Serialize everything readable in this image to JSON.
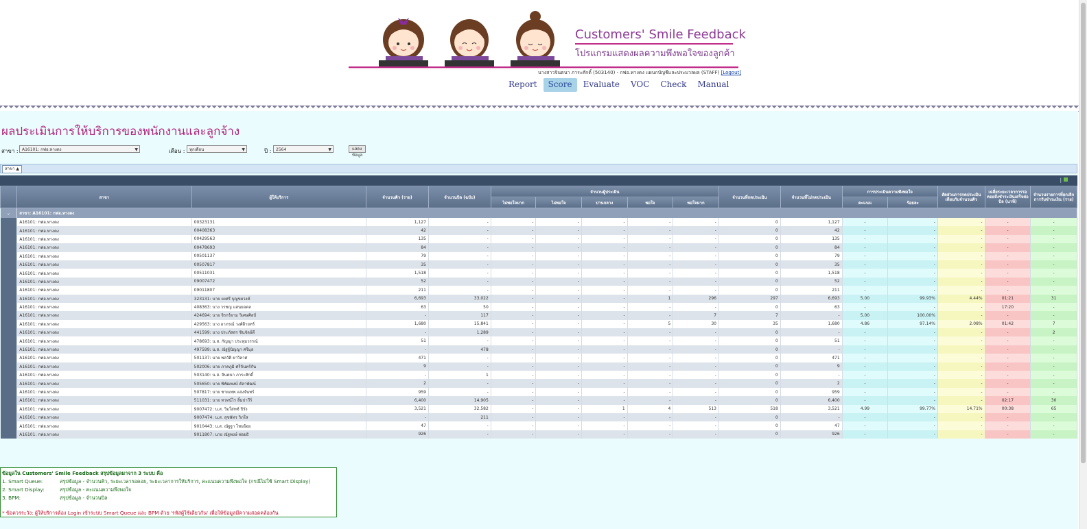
{
  "brand": {
    "title": "Customers' Smile Feedback",
    "subtitle": "โปรแกรมแสดงผลความพึงพอใจของลูกค้า"
  },
  "user": {
    "text": "นางสาวจินตนา ภาระศักดิ์ (503140) - กฟอ.ทางดง แผนกบัญชีและประมวลผล (STAFF)",
    "logout": "[Logout]"
  },
  "menu": [
    {
      "label": "Report",
      "active": false
    },
    {
      "label": "Score",
      "active": true
    },
    {
      "label": "Evaluate",
      "active": false
    },
    {
      "label": "VOC",
      "active": false
    },
    {
      "label": "Check",
      "active": false
    },
    {
      "label": "Manual",
      "active": false
    }
  ],
  "page": {
    "title": "ผลประเมินการให้บริการของพนักงานและลูกจ้าง"
  },
  "filters": {
    "branch_label": "สาขา :",
    "branch_value": "A16101: กฟอ.ทางดง",
    "month_label": "เดือน :",
    "month_value": "ทุกเดือน",
    "year_label": "ปี :",
    "year_value": "2564",
    "submit_label": "แสดงข้อมูล"
  },
  "grouping": {
    "chip": "สาขา ▲"
  },
  "columns": {
    "branch": "สาขา",
    "staff": "ผู้ให้บริการ",
    "queue": "จำนวนคิว (ราย)",
    "bill": "จำนวนบิล (ฉบับ)",
    "raters": "จำนวนผู้ประเมิน",
    "r1": "ไม่พอใจมาก",
    "r2": "ไม่พอใจ",
    "r3": "ปานกลาง",
    "r4": "พอใจ",
    "r5": "พอใจมาก",
    "pressed": "จำนวนที่กดประเมิน",
    "notpressed": "จำนวนที่ไม่กดประเมิน",
    "satisfaction": "การประเมินความพึงพอใจ",
    "score": "คะแนน",
    "percent": "ร้อยละ",
    "ratio": "สัดส่วนการกดประเมินเทียบกับจำนวนคิว",
    "avgtime": "เฉลี่ยระยะเวลาการรอคอยถึงชำระเงินเสร็จต่อบิล (นาที)",
    "bpm": "จำนวนรายการที่ยกเลิกการรับชำระเงิน (ราย)"
  },
  "group_row": {
    "label": "สาขา: A16101: กฟอ.ทางดง"
  },
  "rows": [
    [
      "A16101: กฟอ.ทางดง",
      "00323131",
      "1,127",
      "-",
      "-",
      "-",
      "-",
      "-",
      "-",
      "0",
      "1,127",
      "-",
      "-",
      "-",
      "-",
      "-"
    ],
    [
      "A16101: กฟอ.ทางดง",
      "00408363",
      "42",
      "-",
      "-",
      "-",
      "-",
      "-",
      "-",
      "0",
      "42",
      "-",
      "-",
      "-",
      "-",
      "-"
    ],
    [
      "A16101: กฟอ.ทางดง",
      "00429563",
      "135",
      "-",
      "-",
      "-",
      "-",
      "-",
      "-",
      "0",
      "135",
      "-",
      "-",
      "-",
      "-",
      "-"
    ],
    [
      "A16101: กฟอ.ทางดง",
      "00478693",
      "84",
      "-",
      "-",
      "-",
      "-",
      "-",
      "-",
      "0",
      "84",
      "-",
      "-",
      "-",
      "-",
      "-"
    ],
    [
      "A16101: กฟอ.ทางดง",
      "00501137",
      "79",
      "-",
      "-",
      "-",
      "-",
      "-",
      "-",
      "0",
      "79",
      "-",
      "-",
      "-",
      "-",
      "-"
    ],
    [
      "A16101: กฟอ.ทางดง",
      "00507817",
      "35",
      "-",
      "-",
      "-",
      "-",
      "-",
      "-",
      "0",
      "35",
      "-",
      "-",
      "-",
      "-",
      "-"
    ],
    [
      "A16101: กฟอ.ทางดง",
      "00511031",
      "1,518",
      "-",
      "-",
      "-",
      "-",
      "-",
      "-",
      "0",
      "1,518",
      "-",
      "-",
      "-",
      "-",
      "-"
    ],
    [
      "A16101: กฟอ.ทางดง",
      "09007472",
      "52",
      "-",
      "-",
      "-",
      "-",
      "-",
      "-",
      "0",
      "52",
      "-",
      "-",
      "-",
      "-",
      "-"
    ],
    [
      "A16101: กฟอ.ทางดง",
      "09011807",
      "211",
      "-",
      "-",
      "-",
      "-",
      "-",
      "-",
      "0",
      "211",
      "-",
      "-",
      "-",
      "-",
      "-"
    ],
    [
      "A16101: กฟอ.ทางดง",
      "323131: นาย ยงศรี บุญขยวงค์",
      "6,693",
      "33,022",
      "-",
      "-",
      "-",
      "1",
      "296",
      "297",
      "6,693",
      "5.00",
      "99.93%",
      "4.44%",
      "01:21",
      "31"
    ],
    [
      "A16101: กฟอ.ทางดง",
      "408363: นาง วรชญ แสนยอดล",
      "63",
      "50",
      "-",
      "-",
      "-",
      "-",
      "-",
      "0",
      "63",
      "-",
      "-",
      "-",
      "17:20",
      "-"
    ],
    [
      "A16101: กฟอ.ทางดง",
      "424694: นาย จิรกร์ยาม วิเศษศิลป์",
      "-",
      "117",
      "-",
      "-",
      "-",
      "-",
      "7",
      "7",
      "-",
      "5.00",
      "100.00%",
      "-",
      "-",
      "-"
    ],
    [
      "A16101: กฟอ.ทางดง",
      "429563: นาง อาภรณ์ วงศ์ฝ้ายทร์",
      "1,680",
      "15,841",
      "-",
      "-",
      "-",
      "5",
      "30",
      "35",
      "1,680",
      "4.86",
      "97.14%",
      "2.08%",
      "01:42",
      "7"
    ],
    [
      "A16101: กฟอ.ทางดง",
      "441599: นาง ประภัสสร ชินจัลย์ดี",
      "-",
      "1,289",
      "-",
      "-",
      "-",
      "-",
      "-",
      "0",
      "-",
      "-",
      "-",
      "-",
      "-",
      "2"
    ],
    [
      "A16101: กฟอ.ทางดง",
      "478693: น.ส. กัญญา ประทุมวรรณ์",
      "51",
      "-",
      "-",
      "-",
      "-",
      "-",
      "-",
      "0",
      "51",
      "-",
      "-",
      "-",
      "-",
      "-"
    ],
    [
      "A16101: กฟอ.ทางดง",
      "497599: น.ส. ณัฐฐ์นิญญา ศรีมุล",
      "-",
      "478",
      "-",
      "-",
      "-",
      "-",
      "-",
      "0",
      "-",
      "-",
      "-",
      "-",
      "-",
      "-"
    ],
    [
      "A16101: กฟอ.ทางดง",
      "501137: นาย พลวัติ ยาวิลาศ",
      "471",
      "-",
      "-",
      "-",
      "-",
      "-",
      "-",
      "0",
      "471",
      "-",
      "-",
      "-",
      "-",
      "-"
    ],
    [
      "A16101: กฟอ.ทางดง",
      "502006: นาย ภาคภูมิ ศรีจันทร์กัน",
      "9",
      "-",
      "-",
      "-",
      "-",
      "-",
      "-",
      "0",
      "9",
      "-",
      "-",
      "-",
      "-",
      "-"
    ],
    [
      "A16101: กฟอ.ทางดง",
      "503140: น.ส. จินตนา ภาระศักดิ์",
      "-",
      "1",
      "-",
      "-",
      "-",
      "-",
      "-",
      "0",
      "-",
      "-",
      "-",
      "-",
      "-",
      "-"
    ],
    [
      "A16101: กฟอ.ทางดง",
      "505650: นาย พิพัฒพงษ์ ตัลาพัฒน์",
      "2",
      "-",
      "-",
      "-",
      "-",
      "-",
      "-",
      "0",
      "2",
      "-",
      "-",
      "-",
      "-",
      "-"
    ],
    [
      "A16101: กฟอ.ทางดง",
      "507817: นาย ชายเทพ แสงจันทร์",
      "959",
      "-",
      "-",
      "-",
      "-",
      "-",
      "-",
      "0",
      "959",
      "-",
      "-",
      "-",
      "-",
      "-"
    ],
    [
      "A16101: กฟอ.ทางดง",
      "511031: นาย ทวทน์ไร ลิ้มปาวีร์",
      "6,400",
      "14,905",
      "-",
      "-",
      "-",
      "-",
      "-",
      "0",
      "6,400",
      "-",
      "-",
      "-",
      "02:17",
      "30"
    ],
    [
      "A16101: กฟอ.ทางดง",
      "9007472: น.ส. วิมใส่ทซ์ ปิรัง",
      "3,521",
      "32,582",
      "-",
      "-",
      "1",
      "4",
      "513",
      "518",
      "3,521",
      "4.99",
      "99.77%",
      "14.71%",
      "00:38",
      "65"
    ],
    [
      "A16101: กฟอ.ทางดง",
      "9007474: น.ส. สุขพัทร วิภใส",
      "-",
      "211",
      "-",
      "-",
      "-",
      "-",
      "-",
      "0",
      "-",
      "-",
      "-",
      "-",
      "-",
      "-"
    ],
    [
      "A16101: กฟอ.ทางดง",
      "9010443: น.ส. ณัฐฐา ไทยย้อย",
      "47",
      "-",
      "-",
      "-",
      "-",
      "-",
      "-",
      "0",
      "47",
      "-",
      "-",
      "-",
      "-",
      "-"
    ],
    [
      "A16101: กฟอ.ทางดง",
      "9011807: นาย ณัฐพงษ์ พ่อยธิ",
      "926",
      "-",
      "-",
      "-",
      "-",
      "-",
      "-",
      "0",
      "926",
      "-",
      "-",
      "-",
      "-",
      "-"
    ]
  ],
  "note": {
    "heading": "ข้อมูลใน Customers' Smile Feedback สรุปข้อมูลมาจาก 3 ระบบ คือ",
    "items": [
      {
        "label": "1. Smart Queue:",
        "desc": "สรุปข้อมูล - จำนวนคิว, ระยะเวลารอคอย, ระยะเวลาการให้บริการ, คะแนนความพึงพอใจ (กรณีไม่ใช้ Smart Display)"
      },
      {
        "label": "2. Smart Display:",
        "desc": "สรุปข้อมูล - คะแนนความพึงพอใจ"
      },
      {
        "label": "3. BPM:",
        "desc": "สรุปข้อมูล - จำนวนบิล"
      }
    ],
    "warning": "* ข้อควรระวัง: ผู้ให้บริการต้อง Login เข้าระบบ Smart Queue และ BPM ด้วย 'รหัสผู้ใช้เดียวกัน' เพื่อให้ข้อมูลมีความสอดคล้องกัน"
  }
}
